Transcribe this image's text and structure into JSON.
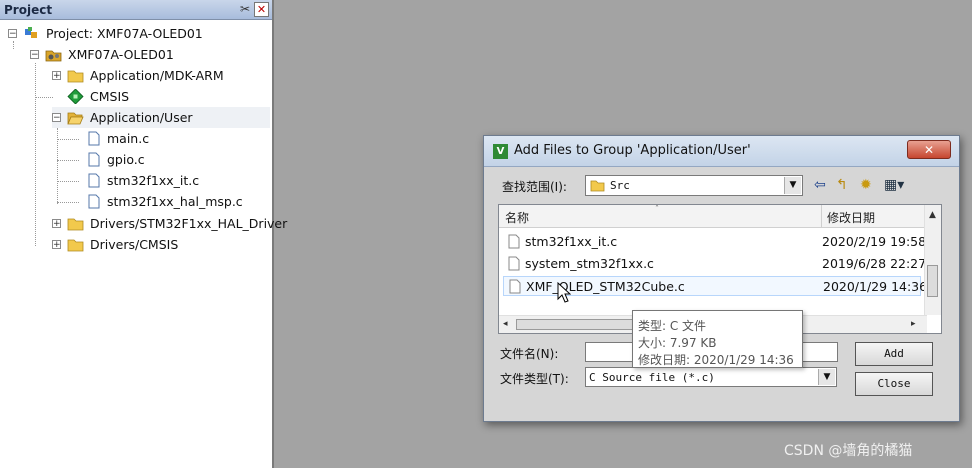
{
  "project_panel": {
    "title": "Project",
    "pin_glyph": "✂",
    "close_glyph": "✕",
    "tree": [
      {
        "label": "Project: XMF07A-OLED01",
        "icon": "project-icon",
        "expander": "−"
      },
      {
        "label": "XMF07A-OLED01",
        "icon": "target-icon",
        "expander": "−"
      },
      {
        "label": "Application/MDK-ARM",
        "icon": "folder-icon",
        "expander": "+"
      },
      {
        "label": "CMSIS",
        "icon": "cmsis-diamond-icon"
      },
      {
        "label": "Application/User",
        "icon": "open-folder-icon",
        "expander": "−"
      },
      {
        "label": "main.c",
        "icon": "file-icon"
      },
      {
        "label": "gpio.c",
        "icon": "file-icon"
      },
      {
        "label": "stm32f1xx_it.c",
        "icon": "file-icon"
      },
      {
        "label": "stm32f1xx_hal_msp.c",
        "icon": "file-icon"
      },
      {
        "label": "Drivers/STM32F1xx_HAL_Driver",
        "icon": "folder-icon",
        "expander": "+"
      },
      {
        "label": "Drivers/CMSIS",
        "icon": "folder-icon",
        "expander": "+"
      }
    ]
  },
  "dialog": {
    "app_icon_glyph": "V",
    "title": "Add Files to Group 'Application/User'",
    "close_glyph": "✕",
    "look_in_label": "查找范围(I):",
    "look_in_value": "Src",
    "dropdown_glyph": "▼",
    "toolbar": {
      "back": "⇦",
      "up": "↰",
      "new_folder": "✹",
      "view": "▦▾"
    },
    "columns": {
      "name": "名称",
      "modified": "修改日期",
      "sort_glyph": "˄"
    },
    "files": [
      {
        "name": "stm32f1xx_it.c",
        "modified": "2020/2/19 19:58"
      },
      {
        "name": "system_stm32f1xx.c",
        "modified": "2019/6/28 22:27"
      },
      {
        "name": "XMF_OLED_STM32Cube.c",
        "modified": "2020/1/29 14:36"
      }
    ],
    "scroll_glyphs": {
      "up": "▲",
      "down": "▼",
      "left": "◂",
      "right": "▸"
    },
    "file_name_label": "文件名(N):",
    "file_name_value": "",
    "file_type_label": "文件类型(T):",
    "file_type_value": "C Source file (*.c)",
    "add_button": "Add",
    "close_button": "Close"
  },
  "tooltip": {
    "type": "类型: C 文件",
    "size": "大小: 7.97 KB",
    "modified": "修改日期: 2020/1/29 14:36"
  },
  "watermark": "CSDN @墙角的橘猫",
  "colors": {
    "background": "#a3a3a3",
    "panel_title": "#a8bcdc",
    "close_red": "#c6462f"
  }
}
